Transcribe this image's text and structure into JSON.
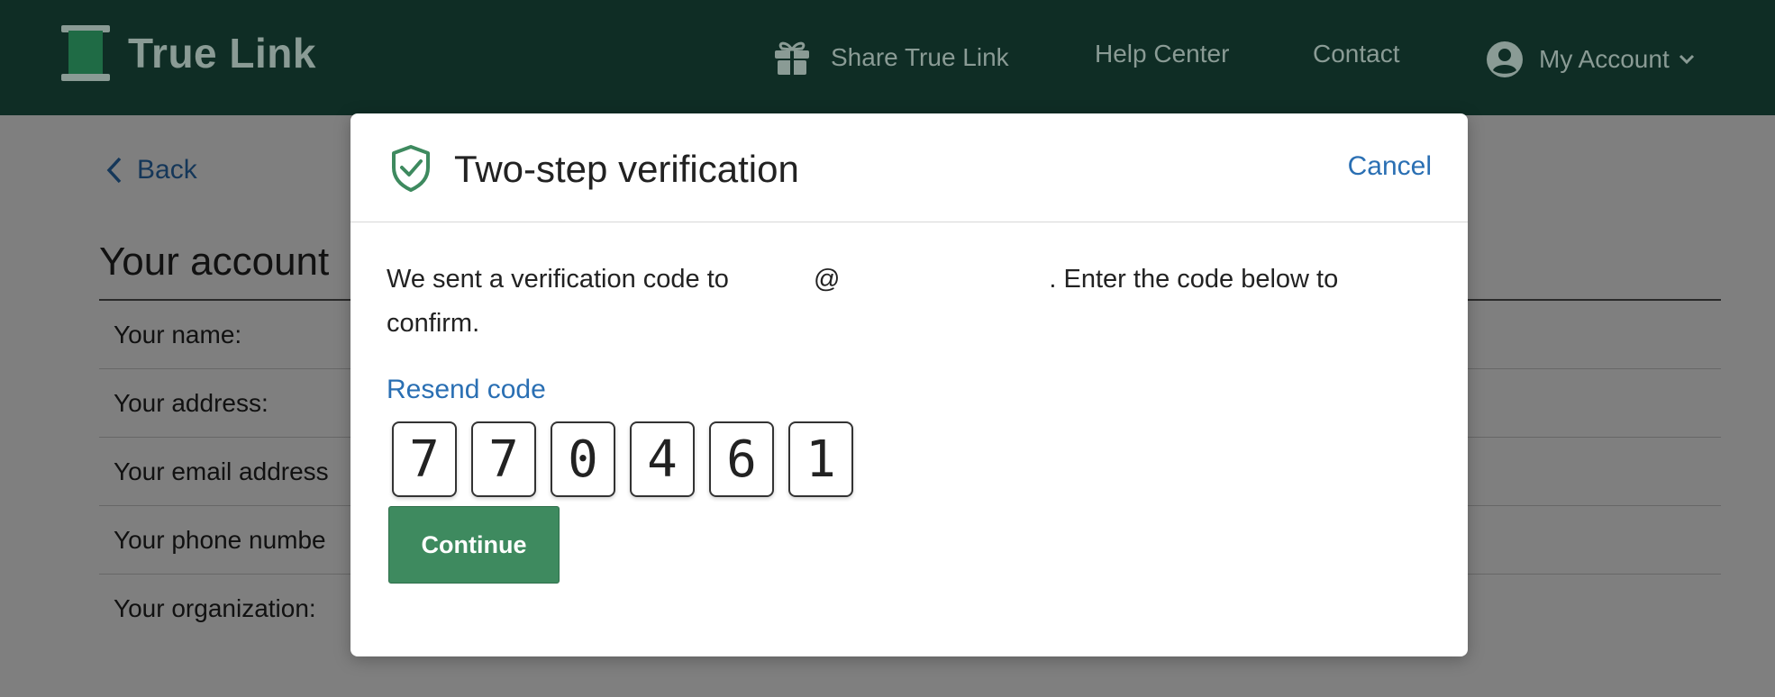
{
  "nav": {
    "brand": "True Link",
    "share": "Share True Link",
    "help": "Help Center",
    "contact": "Contact",
    "account": "My Account"
  },
  "page": {
    "back": "Back",
    "title": "Your account",
    "rows": [
      "Your name:",
      "Your address:",
      "Your email address",
      "Your phone numbe",
      "Your organization:"
    ]
  },
  "modal": {
    "title": "Two-step verification",
    "cancel": "Cancel",
    "message_start": "We sent a verification code to",
    "message_at": "@",
    "message_end": ". Enter the code below to confirm.",
    "resend": "Resend code",
    "code": [
      "7",
      "7",
      "0",
      "4",
      "6",
      "1"
    ],
    "continue": "Continue"
  },
  "colors": {
    "nav_bg": "#0f2d25",
    "nav_text": "#8a9b95",
    "link": "#2a6fb3",
    "primary_button": "#3e8a5f",
    "shield": "#3e8a5f"
  },
  "icons": {
    "logo": "spool-logo-icon",
    "share": "gift-icon",
    "account": "user-circle-icon",
    "account_menu": "chevron-down-icon",
    "back": "chevron-left-icon",
    "modal": "shield-check-icon"
  }
}
